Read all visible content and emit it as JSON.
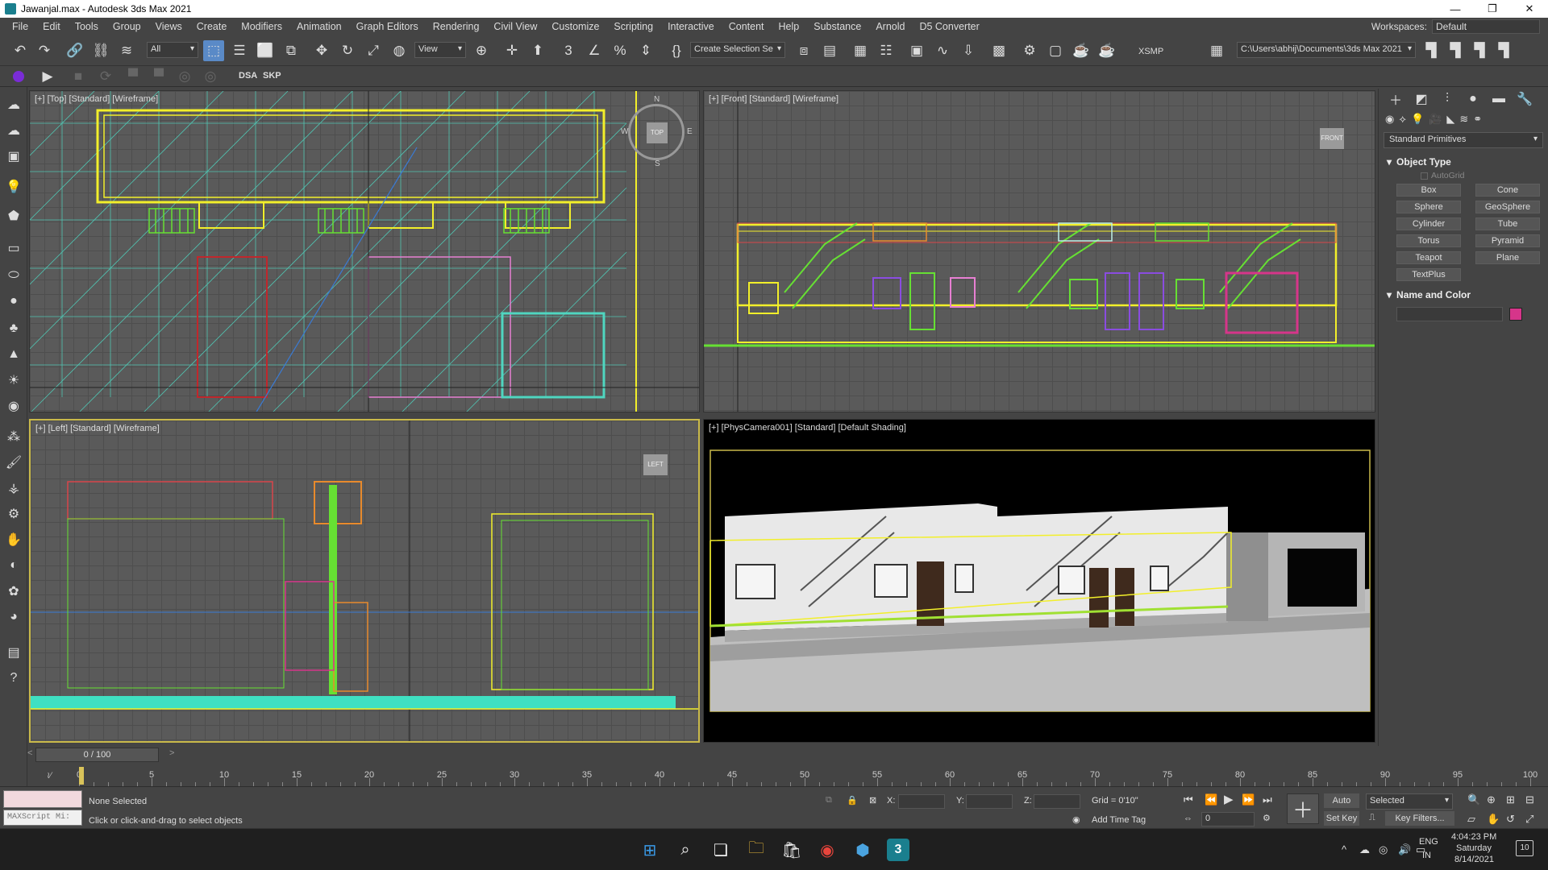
{
  "window": {
    "title": "Jawanjal.max - Autodesk 3ds Max 2021",
    "minimize": "—",
    "maximize": "❐",
    "close": "✕"
  },
  "menu": [
    "File",
    "Edit",
    "Tools",
    "Group",
    "Views",
    "Create",
    "Modifiers",
    "Animation",
    "Graph Editors",
    "Rendering",
    "Civil View",
    "Customize",
    "Scripting",
    "Interactive",
    "Content",
    "Help",
    "Substance",
    "Arnold",
    "D5 Converter"
  ],
  "workspace": {
    "label": "Workspaces:",
    "value": "Default"
  },
  "toolbar": {
    "filter": "All",
    "ref_coord": "View",
    "selection_set": "Create Selection Se",
    "xsmp": "XSMP",
    "project_path": "C:\\Users\\abhij\\Documents\\3ds Max 2021",
    "dsa": "DSA",
    "skp": "SKP"
  },
  "viewports": {
    "top": {
      "label": "[+] [Top] [Standard] [Wireframe]"
    },
    "front": {
      "label": "[+] [Front] [Standard] [Wireframe]"
    },
    "left": {
      "label": "[+] [Left] [Standard] [Wireframe]"
    },
    "camera": {
      "label": "[+] [PhysCamera001] [Standard] [Default Shading]"
    },
    "viewcube_top": "TOP",
    "viewcube_front": "FRONT",
    "viewcube_left": "LEFT",
    "compass": {
      "n": "N",
      "s": "S",
      "e": "E",
      "w": "W"
    }
  },
  "command_panel": {
    "dropdown": "Standard Primitives",
    "object_type_title": "Object Type",
    "autogrid": "AutoGrid",
    "primitives": [
      "Box",
      "Cone",
      "Sphere",
      "GeoSphere",
      "Cylinder",
      "Tube",
      "Torus",
      "Pyramid",
      "Teapot",
      "Plane",
      "TextPlus"
    ],
    "name_color_title": "Name and Color",
    "object_color": "#d6358a"
  },
  "timeline": {
    "slider": "0 / 100",
    "ticks": [
      0,
      5,
      10,
      15,
      20,
      25,
      30,
      35,
      40,
      45,
      50,
      55,
      60,
      65,
      70,
      75,
      80,
      85,
      90,
      95,
      100
    ]
  },
  "status": {
    "maxscript": "MAXScript Mi:",
    "selection": "None Selected",
    "prompt": "Click or click-and-drag to select objects",
    "x_label": "X:",
    "y_label": "Y:",
    "z_label": "Z:",
    "grid": "Grid = 0'10\"",
    "add_time_tag": "Add Time Tag",
    "auto_key": "Auto Key",
    "set_key": "Set Key",
    "key_mode": "Selected",
    "key_filters": "Key Filters...",
    "frame": "0"
  },
  "taskbar": {
    "time": "4:04:23 PM",
    "day": "Saturday",
    "date": "8/14/2021",
    "lang1": "ENG",
    "lang2": "IN",
    "notifications": "10"
  }
}
